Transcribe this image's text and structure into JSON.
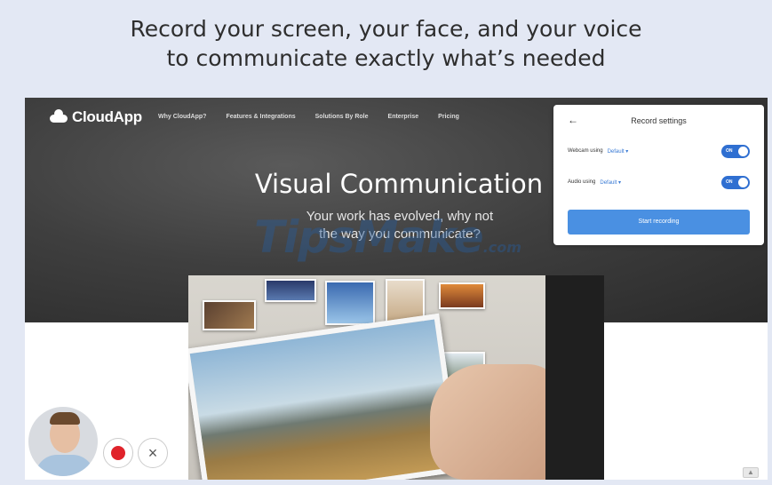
{
  "banner": {
    "line1": "Record your screen, your face, and your voice",
    "line2": "to communicate exactly what’s needed"
  },
  "site": {
    "logo": "CloudApp",
    "nav": [
      "Why CloudApp?",
      "Features & Integrations",
      "Solutions By Role",
      "Enterprise",
      "Pricing"
    ],
    "hero_title": "Visual Communication",
    "hero_subtitle_1": "Your work has evolved, why not",
    "hero_subtitle_2": "the way you communicate?"
  },
  "watermark": {
    "main": "TipsMake",
    "suffix": ".com"
  },
  "record_settings": {
    "back_icon": "←",
    "title": "Record settings",
    "webcam_label": "Webcam using",
    "webcam_value": "Default ▾",
    "webcam_toggle": "ON",
    "audio_label": "Audio using",
    "audio_value": "Default ▾",
    "audio_toggle": "ON",
    "start_button": "Start recording"
  },
  "controls": {
    "record_icon": "record-icon",
    "close_icon": "×",
    "scroll_icon": "▲"
  },
  "colors": {
    "accent": "#4a90e2",
    "toggle_on": "#2f6fd1",
    "record_red": "#e0232b",
    "hero_dark": "#3a3a3a",
    "banner_bg": "#e3e8f4"
  }
}
